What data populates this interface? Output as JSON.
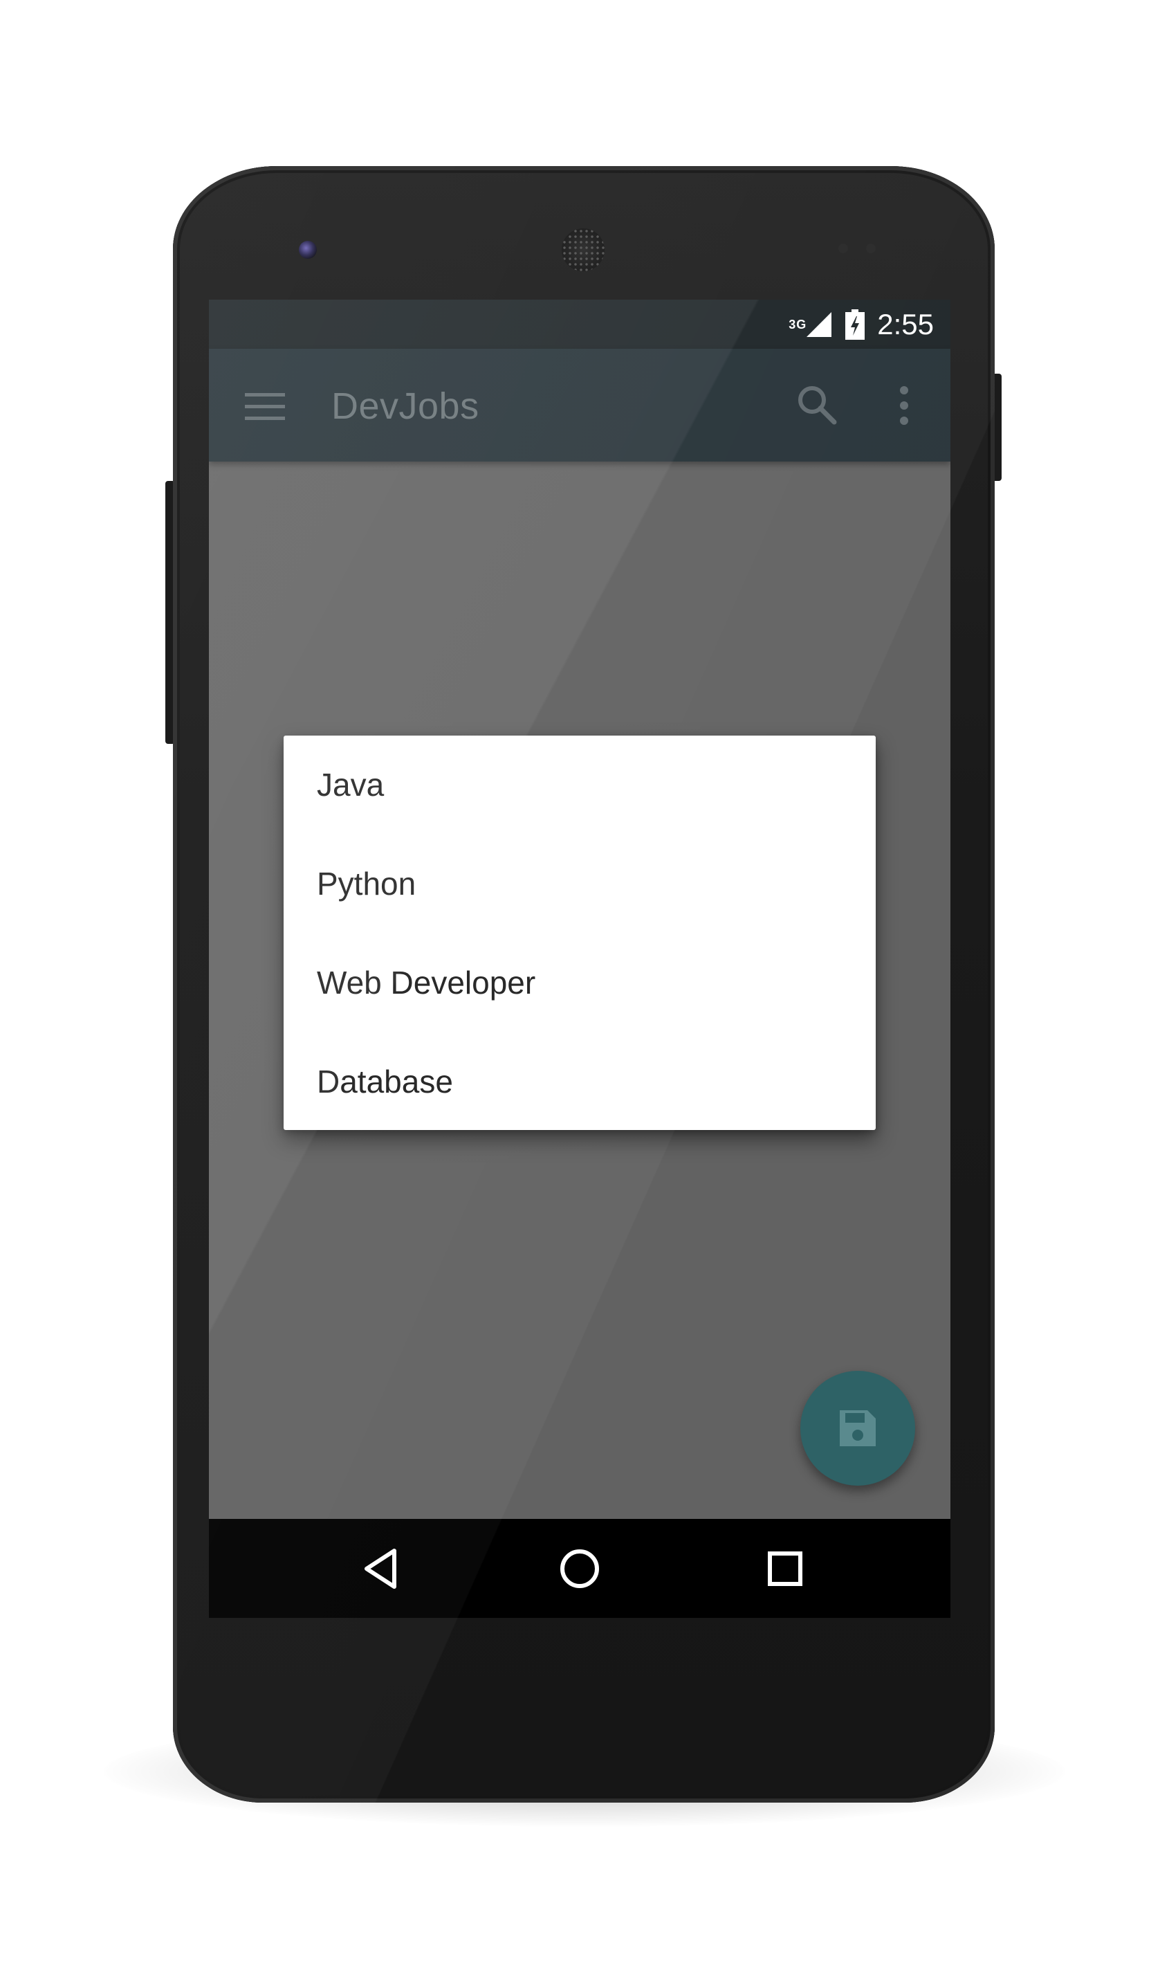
{
  "status_bar": {
    "network_type": "3G",
    "time": "2:55",
    "icons": [
      "signal-icon",
      "battery-charging-icon"
    ]
  },
  "app_bar": {
    "title": "DevJobs",
    "icons": [
      "menu-icon",
      "search-icon",
      "more-vert-icon"
    ]
  },
  "dialog": {
    "items": [
      {
        "label": "Java"
      },
      {
        "label": "Python"
      },
      {
        "label": "Web Developer"
      },
      {
        "label": "Database"
      }
    ]
  },
  "fab": {
    "icon": "save-icon",
    "color": "#2e6266"
  },
  "nav_bar": {
    "icons": [
      "back-icon",
      "home-icon",
      "recents-icon"
    ]
  },
  "colors": {
    "status_bar": "#1d2427",
    "app_bar": "#263238",
    "scrim": "#626262"
  }
}
